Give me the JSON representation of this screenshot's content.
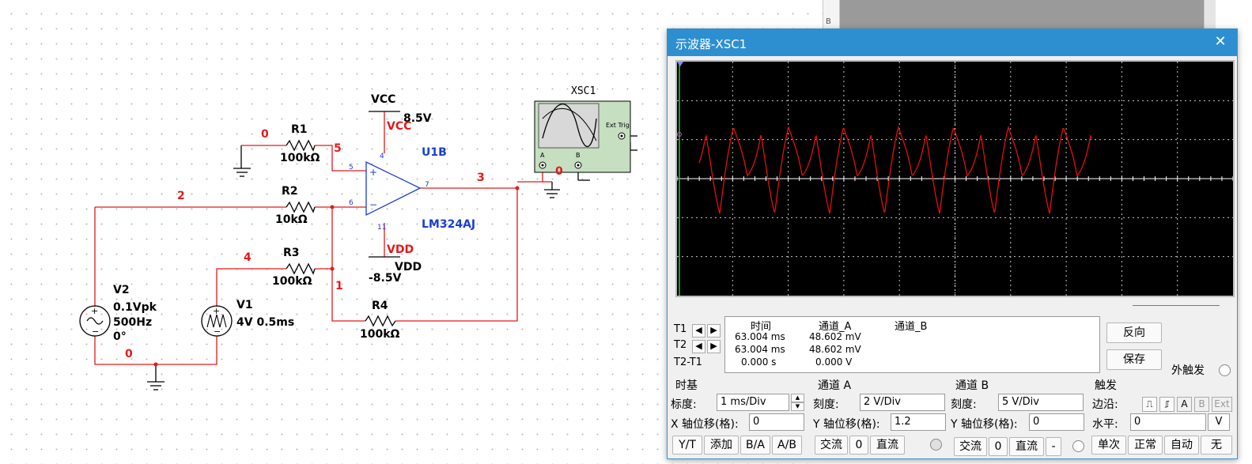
{
  "schematic": {
    "net_labels": {
      "n0_top": "0",
      "n5": "5",
      "n2": "2",
      "n3": "3",
      "n4": "4",
      "n1": "1",
      "n0_bottom": "0",
      "n0_scope": "0"
    },
    "r1": {
      "name": "R1",
      "value": "100kΩ"
    },
    "r2": {
      "name": "R2",
      "value": "10kΩ"
    },
    "r3": {
      "name": "R3",
      "value": "100kΩ"
    },
    "r4": {
      "name": "R4",
      "value": "100kΩ"
    },
    "v2": {
      "name": "V2",
      "line1": "0.1Vpk",
      "line2": "500Hz",
      "line3": "0°"
    },
    "v1": {
      "name": "V1",
      "line1": "4V 0.5ms"
    },
    "vcc": {
      "label": "VCC",
      "value": "8.5V",
      "pin_label": "VCC"
    },
    "vdd": {
      "label": "VDD",
      "value": "-8.5V",
      "pin_label": "VDD"
    },
    "opamp": {
      "ref": "U1B",
      "part": "LM324AJ",
      "pin5": "5",
      "pin6": "6",
      "pin7": "7",
      "pin4": "4",
      "pin11": "11"
    },
    "xsc": {
      "name": "XSC1",
      "ext_trig": "Ext Trig",
      "a": "A",
      "b": "B"
    },
    "strip_letter": "B"
  },
  "scope": {
    "title": "示波器-XSC1",
    "close": "✕",
    "readout": {
      "t1": "T1",
      "t2": "T2",
      "t2t1": "T2-T1",
      "headers": {
        "time": "时间",
        "cha": "通道_A",
        "chb": "通道_B"
      },
      "rows": [
        {
          "time": "63.004 ms",
          "cha": "48.602 mV"
        },
        {
          "time": "63.004 ms",
          "cha": "48.602 mV"
        },
        {
          "time": "0.000 s",
          "cha": "0.000 V"
        }
      ]
    },
    "buttons": {
      "reverse": "反向",
      "save": "保存",
      "ext_trigger": "外触发"
    },
    "timebase": {
      "title": "时基",
      "scale_label": "标度:",
      "scale_value": "1 ms/Div",
      "xpos_label": "X 轴位移(格):",
      "xpos_value": "0",
      "yt": "Y/T",
      "add": "添加",
      "ba": "B/A",
      "ab": "A/B"
    },
    "channel_a": {
      "title": "通道 A",
      "scale_label": "刻度:",
      "scale_value": "2  V/Div",
      "ypos_label": "Y 轴位移(格):",
      "ypos_value": "1.2",
      "ac": "交流",
      "zero": "0",
      "dc": "直流"
    },
    "channel_b": {
      "title": "通道 B",
      "scale_label": "刻度:",
      "scale_value": "5  V/Div",
      "ypos_label": "Y 轴位移(格):",
      "ypos_value": "0",
      "ac": "交流",
      "zero": "0",
      "dc": "直流",
      "minus": "-"
    },
    "trigger": {
      "title": "触发",
      "edge_label": "边沿:",
      "level_label": "水平:",
      "level_value": "0",
      "level_unit": "V",
      "a": "A",
      "b": "B",
      "ext": "Ext",
      "single": "单次",
      "normal": "正常",
      "auto": "自动",
      "none": "无"
    },
    "colors": {
      "trace": "#e01010",
      "grid": "#c8c8c8",
      "cursor": "#22cc22",
      "title_bg": "#2e8fd0"
    }
  }
}
